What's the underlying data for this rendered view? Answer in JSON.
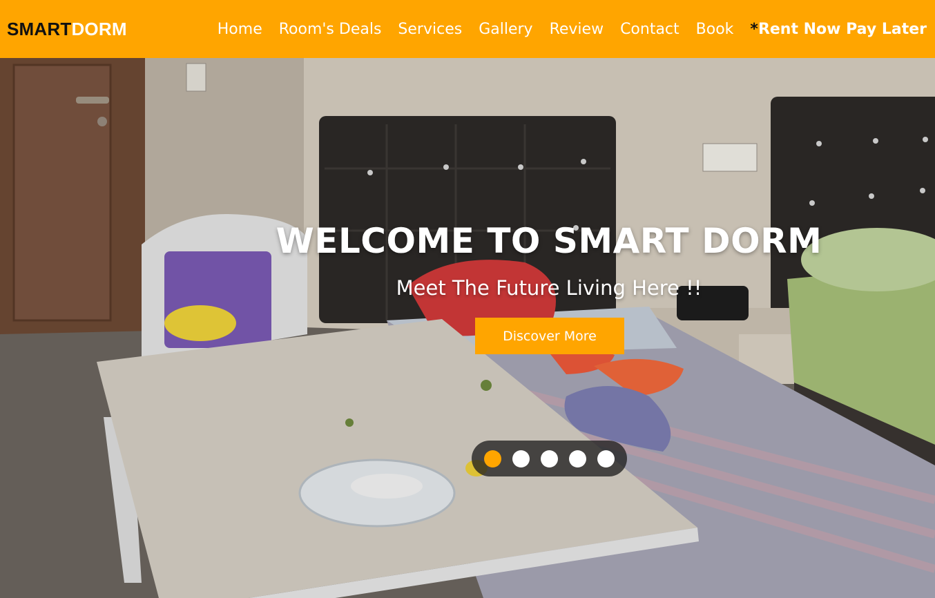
{
  "brand": {
    "part1": "SMART",
    "part2": "DORM"
  },
  "nav": {
    "items": [
      {
        "label": "Home"
      },
      {
        "label": "Room's Deals"
      },
      {
        "label": "Services"
      },
      {
        "label": "Gallery"
      },
      {
        "label": "Review"
      },
      {
        "label": "Contact"
      },
      {
        "label": "Book"
      }
    ],
    "promo_prefix": "*",
    "promo_text": "Rent Now Pay Later"
  },
  "hero": {
    "title": "WELCOME TO SMART DORM",
    "subtitle": "Meet The Future Living Here !!",
    "cta_label": "Discover More",
    "background": "dorm room photo",
    "slider": {
      "slide_count": 5,
      "active_index": 0
    }
  },
  "colors": {
    "accent": "#ffa500",
    "text_on_accent": "#ffffff",
    "logo_dark": "#111111"
  }
}
